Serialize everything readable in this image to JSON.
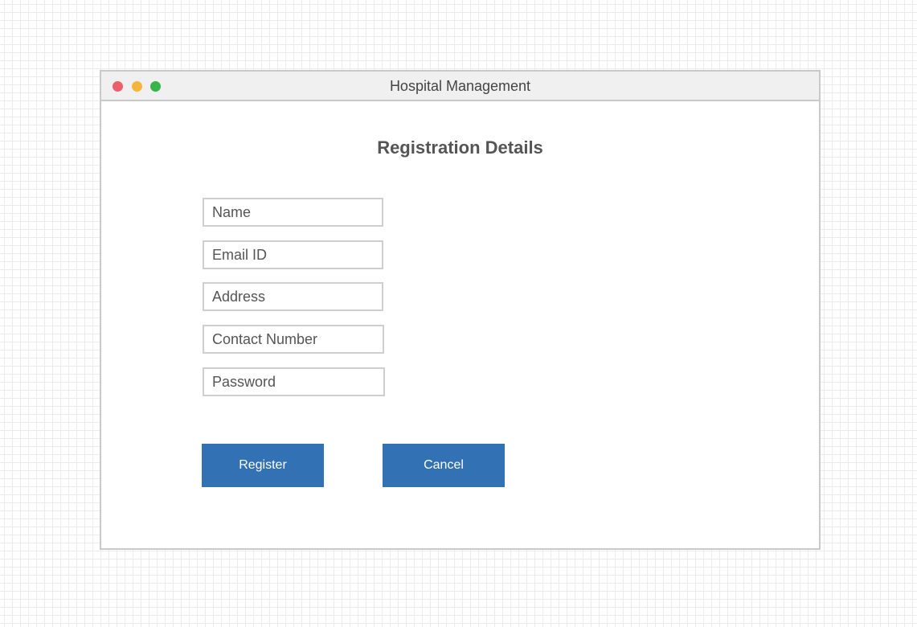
{
  "window": {
    "title": "Hospital Management",
    "controls": {
      "close_color": "#ec5f6c",
      "minimize_color": "#f5b43a",
      "maximize_color": "#38b449"
    }
  },
  "form": {
    "heading": "Registration Details",
    "fields": {
      "name": {
        "value": "",
        "placeholder": "Name"
      },
      "email": {
        "value": "",
        "placeholder": "Email ID"
      },
      "address": {
        "value": "",
        "placeholder": "Address"
      },
      "contact": {
        "value": "",
        "placeholder": "Contact Number"
      },
      "password": {
        "value": "",
        "placeholder": "Password"
      }
    },
    "buttons": {
      "register_label": "Register",
      "cancel_label": "Cancel",
      "color": "#3371b5"
    }
  }
}
